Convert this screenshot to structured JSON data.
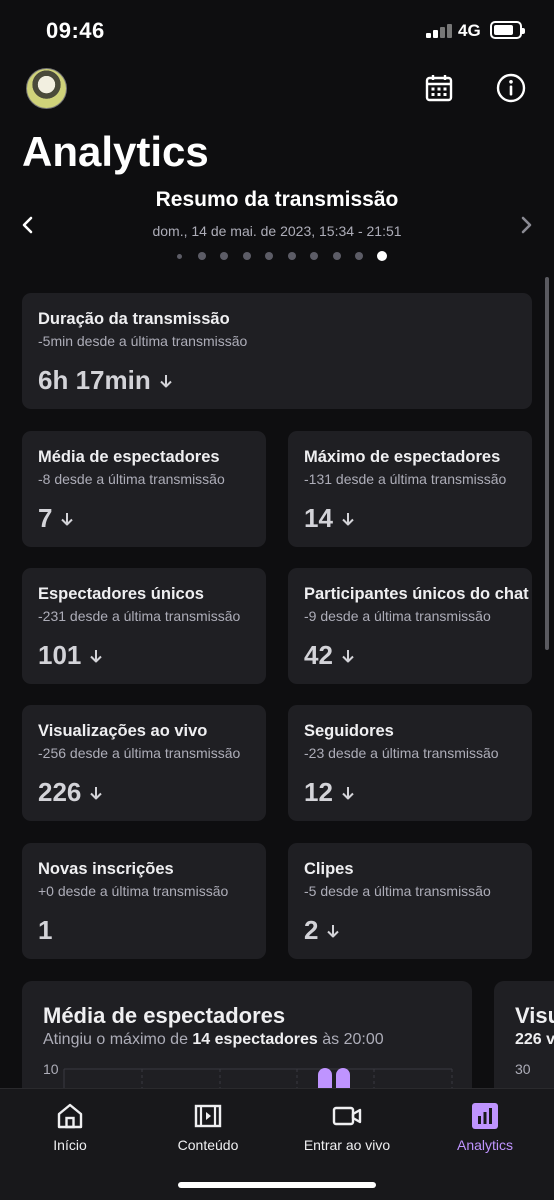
{
  "status_bar": {
    "time": "09:46",
    "network": "4G"
  },
  "header": {
    "title": "Analytics"
  },
  "summary": {
    "title": "Resumo da transmissão",
    "date": "dom., 14 de mai. de 2023, 15:34 - 21:51",
    "page_count": 10,
    "active_page": 10
  },
  "cards": [
    {
      "title": "Duração da transmissão",
      "subtitle": "-5min desde a última transmissão",
      "value": "6h 17min",
      "trend": "down"
    },
    {
      "title": "Média de espectadores",
      "subtitle": "-8 desde a última transmissão",
      "value": "7",
      "trend": "down"
    },
    {
      "title": "Máximo de espectadores",
      "subtitle": "-131 desde a última transmissão",
      "value": "14",
      "trend": "down"
    },
    {
      "title": "Espectadores únicos",
      "subtitle": "-231 desde a última transmissão",
      "value": "101",
      "trend": "down"
    },
    {
      "title": "Participantes únicos do chat",
      "subtitle": "-9 desde a última transmissão",
      "value": "42",
      "trend": "down"
    },
    {
      "title": "Visualizações ao vivo",
      "subtitle": "-256 desde a última transmissão",
      "value": "226",
      "trend": "down"
    },
    {
      "title": "Seguidores",
      "subtitle": "-23 desde a última transmissão",
      "value": "12",
      "trend": "down"
    },
    {
      "title": "Novas inscrições",
      "subtitle": "+0 desde a última transmissão",
      "value": "1",
      "trend": "none"
    },
    {
      "title": "Clipes",
      "subtitle": "-5 desde a última transmissão",
      "value": "2",
      "trend": "down"
    }
  ],
  "charts": [
    {
      "title": "Média de espectadores",
      "subtitle_pre": "Atingiu o máximo de ",
      "subtitle_bold": "14 espectadores",
      "subtitle_post": " às 20:00",
      "y_tick_top": "10"
    },
    {
      "title": "Visu",
      "subtitle": "226 v",
      "y_tick_top": "30"
    }
  ],
  "bottom_nav": [
    {
      "label": "Início",
      "icon": "home-icon"
    },
    {
      "label": "Conteúdo",
      "icon": "film-icon"
    },
    {
      "label": "Entrar ao vivo",
      "icon": "video-camera-icon"
    },
    {
      "label": "Analytics",
      "icon": "analytics-icon",
      "active": true
    }
  ],
  "colors": {
    "background": "#0e0e10",
    "card": "#1f1f23",
    "accent": "#bf94ff",
    "muted_text": "#adadb8"
  }
}
